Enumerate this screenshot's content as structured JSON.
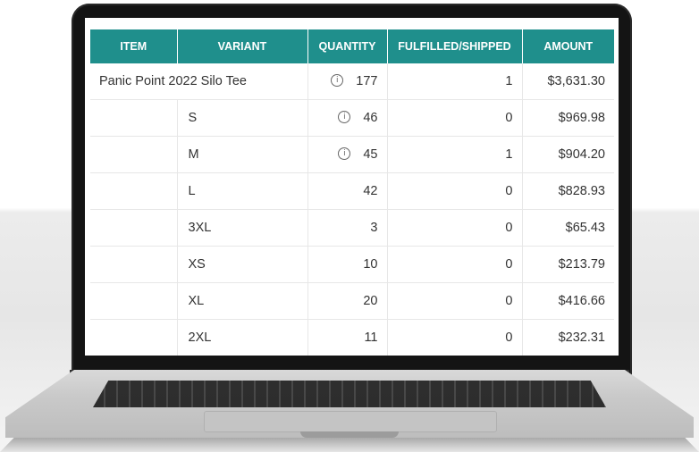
{
  "table": {
    "headers": {
      "item": "ITEM",
      "variant": "VARIANT",
      "quantity": "QUANTITY",
      "fulfilled": "FULFILLED/SHIPPED",
      "amount": "AMOUNT"
    },
    "product": {
      "name": "Panic Point 2022 Silo Tee",
      "quantity": "177",
      "fulfilled": "1",
      "amount": "$3,631.30",
      "info_icon": "info-icon"
    },
    "rows": [
      {
        "variant": "S",
        "quantity": "46",
        "fulfilled": "0",
        "amount": "$969.98"
      },
      {
        "variant": "M",
        "quantity": "45",
        "fulfilled": "1",
        "amount": "$904.20"
      },
      {
        "variant": "L",
        "quantity": "42",
        "fulfilled": "0",
        "amount": "$828.93"
      },
      {
        "variant": "3XL",
        "quantity": "3",
        "fulfilled": "0",
        "amount": "$65.43"
      },
      {
        "variant": "XS",
        "quantity": "10",
        "fulfilled": "0",
        "amount": "$213.79"
      },
      {
        "variant": "XL",
        "quantity": "20",
        "fulfilled": "0",
        "amount": "$416.66"
      },
      {
        "variant": "2XL",
        "quantity": "11",
        "fulfilled": "0",
        "amount": "$232.31"
      }
    ]
  },
  "colors": {
    "header_bg": "#1f8f8c",
    "header_text": "#ffffff"
  }
}
